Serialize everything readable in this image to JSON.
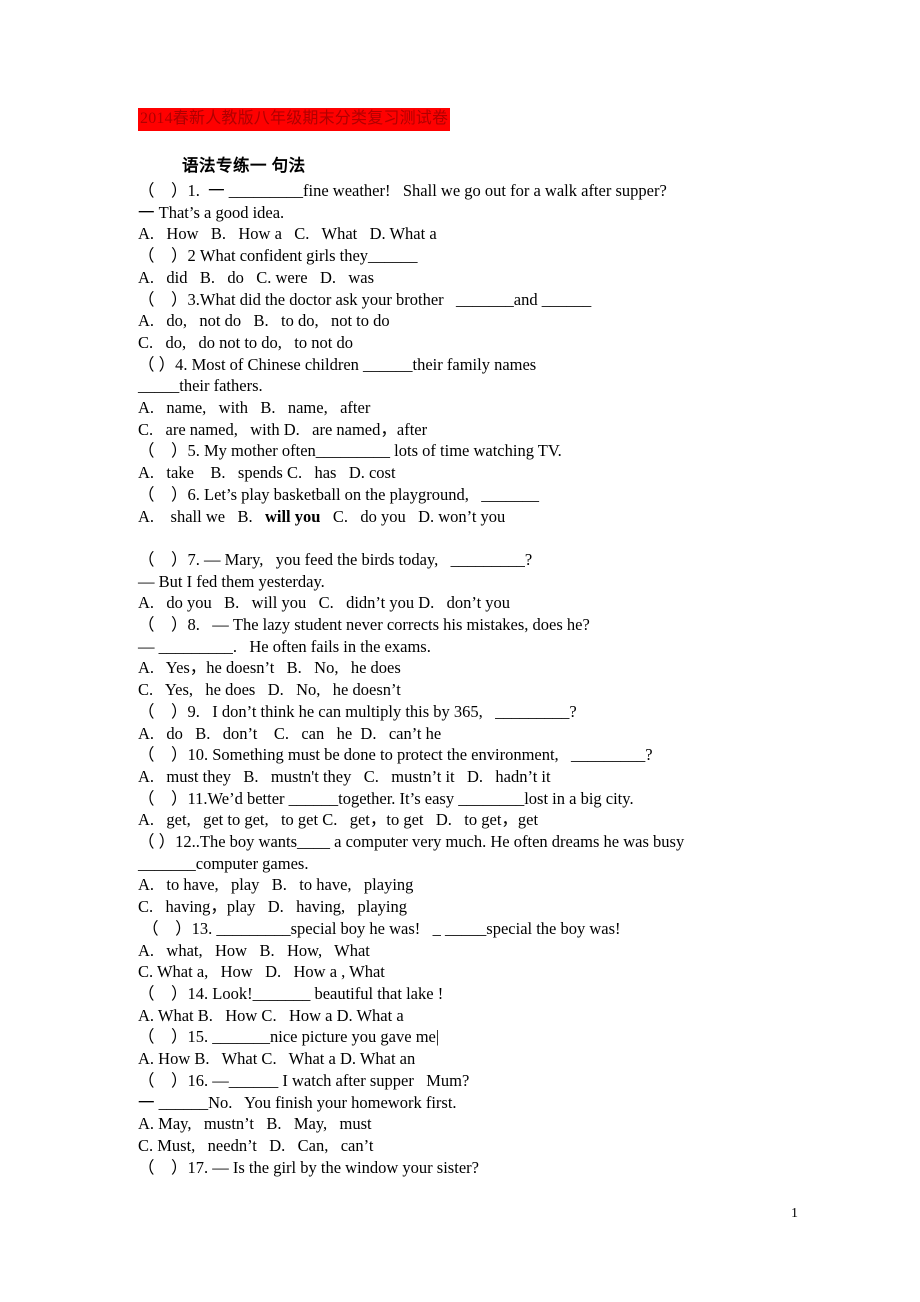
{
  "document": {
    "title": "2014春新人教版八年级期末分类复习测试卷",
    "title_bg_color": "#FF0000",
    "title_text_color": "#B00000",
    "section_heading": "语法专练一  句法",
    "page_number": "1"
  },
  "lines": [
    {
      "id": "q1-stem",
      "text": "（    ）1.  一 _________fine weather!   Shall we go out for a walk after supper?"
    },
    {
      "id": "q1-reply",
      "text": "一 That’s a good idea."
    },
    {
      "id": "q1-opts",
      "text": "A.   How   B.   How a   C.   What   D. What a"
    },
    {
      "id": "q2-stem",
      "text": "（    ）2 What confident girls they______"
    },
    {
      "id": "q2-opts",
      "text": "A.   did   B.   do   C. were   D.   was"
    },
    {
      "id": "q3-stem",
      "text": "（    ）3.What did the doctor ask your brother   _______and ______"
    },
    {
      "id": "q3-optsAB",
      "text": "A.   do,   not do   B.   to do,   not to do"
    },
    {
      "id": "q3-optsC",
      "text": "C.   do,   do not to do,   to not do"
    },
    {
      "id": "q4-stem",
      "text": "（    ）4. Most of Chinese children ______their family names",
      "justify": true
    },
    {
      "id": "q4-stem2",
      "text": "_____their fathers."
    },
    {
      "id": "q4-optsAB",
      "text": "A.   name,   with   B.   name,   after"
    },
    {
      "id": "q4-optsCD",
      "text": "C.   are named,   with D.   are named，after"
    },
    {
      "id": "q5-stem",
      "text": "（    ）5. My mother often_________ lots of time watching TV."
    },
    {
      "id": "q5-opts",
      "text": "A.   take    B.   spends C.   has   D. cost"
    },
    {
      "id": "q6-stem",
      "text": "（    ）6. Let’s play basketball on the playground,   _______"
    },
    {
      "id": "q6-opts",
      "text": "A.    shall we   B.   ",
      "bold_tail": "will you",
      "tail": "   C.   do you   D. won’t you"
    },
    {
      "id": "blank-1",
      "text": "",
      "spacer": true
    },
    {
      "id": "q7-stem",
      "text": "（    ）7. — Mary,   you feed the birds today,   _________?"
    },
    {
      "id": "q7-reply",
      "text": "— But I fed them yesterday."
    },
    {
      "id": "q7-opts",
      "text": "A.   do you   B.   will you   C.   didn’t you D.   don’t you"
    },
    {
      "id": "q8-stem",
      "text": "（    ）8.   — The lazy student never corrects his mistakes, does he?"
    },
    {
      "id": "q8-reply",
      "text": "— _________.   He often fails in the exams."
    },
    {
      "id": "q8-optsAB",
      "text": "A.   Yes，he doesn’t   B.   No,   he does"
    },
    {
      "id": "q8-optsCD",
      "text": "C.   Yes,   he does   D.   No,   he doesn’t"
    },
    {
      "id": "q9-stem",
      "text": "（    ）9.   I don’t think he can multiply this by 365,   _________?"
    },
    {
      "id": "q9-opts",
      "text": "A.   do   B.   don’t    C.   can   he  D.   can’t he"
    },
    {
      "id": "q10-stem",
      "text": "（    ）10. Something must be done to protect the environment,   _________?"
    },
    {
      "id": "q10-opts",
      "text": "A.   must they   B.   mustn't they   C.   mustn’t it   D.   hadn’t it"
    },
    {
      "id": "q11-stem",
      "text": "（    ）11.We’d better ______together. It’s easy ________lost in a big city."
    },
    {
      "id": "q11-opts",
      "text": "A.   get,   get to get,   to get C.   get，to get   D.   to get，get"
    },
    {
      "id": "q12-stem",
      "text": "（      ）12..The boy wants____ a computer very much.   He often dreams he was busy",
      "justify": true
    },
    {
      "id": "q12-stem2",
      "text": "_______computer games."
    },
    {
      "id": "q12-optsAB",
      "text": "A.   to have,   play   B.   to have,   playing"
    },
    {
      "id": "q12-optsCD",
      "text": "C.   having，play   D.   having,   playing"
    },
    {
      "id": "q13-stem",
      "text": " （    ）13. _________special boy he was!   _ _____special the boy was!"
    },
    {
      "id": "q13-optsAB",
      "text": "A.   what,   How   B.   How,   What"
    },
    {
      "id": "q13-optsCD",
      "text": "C. What a,   How   D.   How a , What"
    },
    {
      "id": "q14-stem",
      "text": "（    ）14. Look!_______ beautiful that lake !"
    },
    {
      "id": "q14-opts",
      "text": "A. What B.   How C.   How a D. What a"
    },
    {
      "id": "q15-stem",
      "text": "（    ）15. _______nice picture you gave me|"
    },
    {
      "id": "q15-opts",
      "text": "A. How B.   What C.   What a D. What an"
    },
    {
      "id": "q16-stem",
      "text": "（    ）16. —______ I watch after supper   Mum?"
    },
    {
      "id": "q16-reply",
      "text": "一 ______No.   You finish your homework first."
    },
    {
      "id": "q16-optsAB",
      "text": "A. May,   mustn’t   B.   May,   must"
    },
    {
      "id": "q16-optsCD",
      "text": "C. Must,   needn’t   D.   Can,   can’t"
    },
    {
      "id": "q17-stem",
      "text": "（    ）17. — Is the girl by the window your sister?"
    }
  ]
}
